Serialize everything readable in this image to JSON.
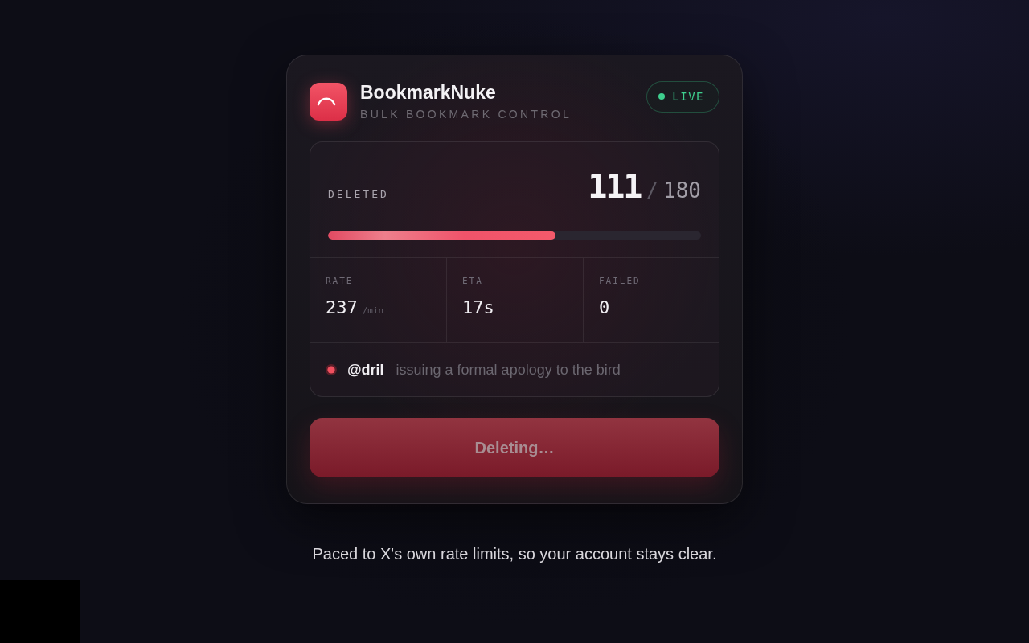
{
  "app": {
    "name": "BookmarkNuke",
    "tagline": "BULK BOOKMARK CONTROL",
    "status": "LIVE"
  },
  "progress": {
    "label": "DELETED",
    "done": "111",
    "separator": "/",
    "total": "180",
    "level": 0.61
  },
  "stats": [
    {
      "label": "RATE",
      "value": "237",
      "unit": "/min"
    },
    {
      "label": "ETA",
      "value": "17s"
    },
    {
      "label": "FAILED",
      "value": "0"
    }
  ],
  "activity": {
    "handle": "@dril",
    "message": "issuing a formal apology to the bird"
  },
  "action_button": {
    "label": "Deleting…",
    "disabled": true
  },
  "footer": "Paced to X's own rate limits, so your account stays clear."
}
